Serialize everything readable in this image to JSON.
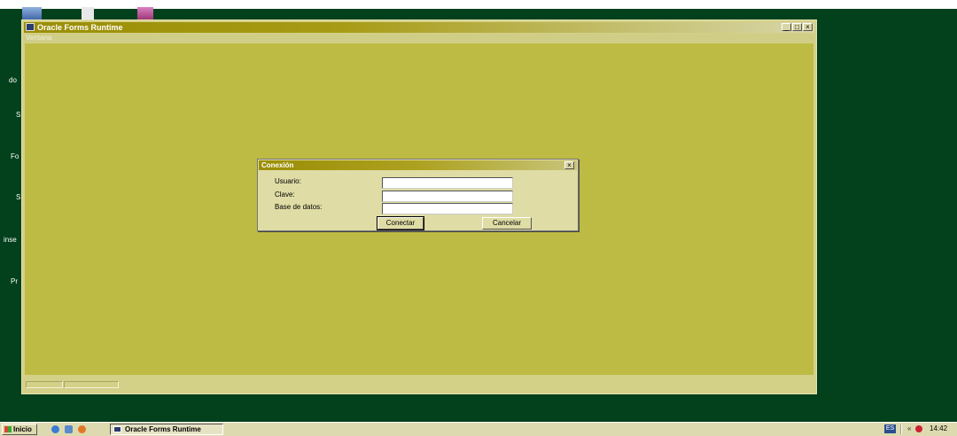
{
  "desktop": {
    "icon_labels": [
      "do",
      "S",
      "Fo",
      "S",
      "inse",
      "Pr"
    ]
  },
  "window": {
    "title": "Oracle Forms Runtime",
    "controls": {
      "minimize": "_",
      "maximize": "□",
      "close": "×"
    },
    "menu": [
      "Ventana"
    ]
  },
  "dialog": {
    "title": "Conexión",
    "close": "×",
    "fields": [
      {
        "label": "Usuario:",
        "value": ""
      },
      {
        "label": "Clave:",
        "value": ""
      },
      {
        "label": "Base de datos:",
        "value": ""
      }
    ],
    "buttons": {
      "connect": "Conectar",
      "cancel": "Cancelar"
    }
  },
  "taskbar": {
    "start": "Inicio",
    "task": "Oracle Forms Runtime",
    "lang": "ES",
    "chevron": "«",
    "clock": "14:42"
  },
  "colors": {
    "desktop": "#03411c",
    "client": "#bdbb43",
    "chrome": "#d3d088",
    "titlebar": "#9a8e06"
  }
}
